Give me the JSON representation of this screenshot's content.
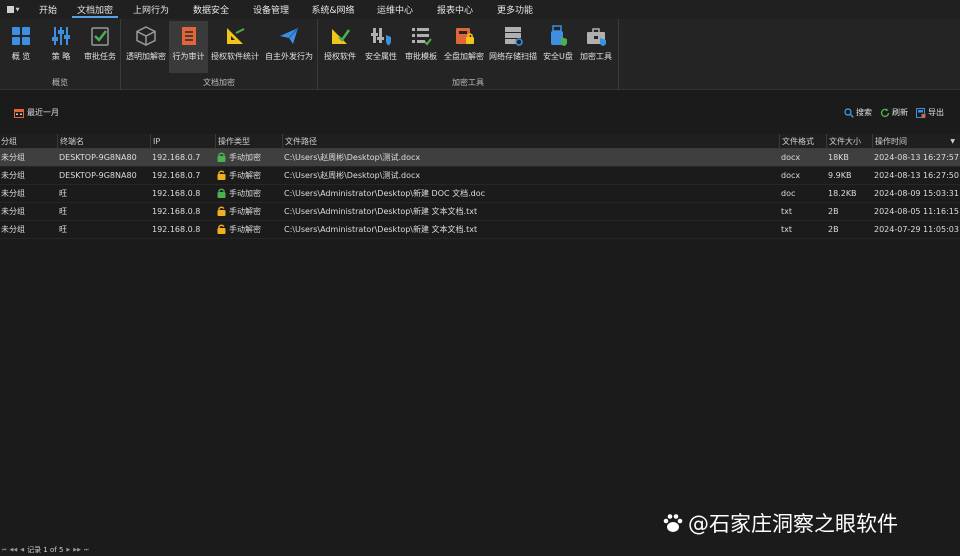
{
  "menubar": {
    "tabs": [
      {
        "label": "开始",
        "active": false
      },
      {
        "label": "文档加密",
        "active": true
      },
      {
        "label": "上网行为",
        "active": false
      },
      {
        "label": "数据安全",
        "active": false
      },
      {
        "label": "设备管理",
        "active": false
      },
      {
        "label": "系统&网络",
        "active": false
      },
      {
        "label": "运维中心",
        "active": false
      },
      {
        "label": "报表中心",
        "active": false
      },
      {
        "label": "更多功能",
        "active": false
      }
    ]
  },
  "ribbon": {
    "groups": [
      {
        "label": "概览",
        "buttons": [
          {
            "label": "概 览",
            "icon": "dashboard-icon",
            "color": "#3d8fe0"
          },
          {
            "label": "策 略",
            "icon": "sliders-icon",
            "color": "#3d8fe0"
          },
          {
            "label": "审批任务",
            "icon": "approval-check-icon",
            "color": "#4caf50"
          }
        ]
      },
      {
        "label": "文档加密",
        "buttons": [
          {
            "label": "透明加解密",
            "icon": "cube-icon",
            "color": "#9a9a9a"
          },
          {
            "label": "行为审计",
            "icon": "audit-log-icon",
            "color": "#e0663a"
          },
          {
            "label": "授权软件统计",
            "icon": "chart-ruler-icon",
            "color": "#f0c419"
          },
          {
            "label": "自主外发行为",
            "icon": "paper-plane-icon",
            "color": "#3d8fe0"
          }
        ]
      },
      {
        "label": "加密工具",
        "buttons": [
          {
            "label": "授权软件",
            "icon": "authorize-icon",
            "color": "#f0c419"
          },
          {
            "label": "安全属性",
            "icon": "security-attr-icon",
            "color": "#b0b0b0"
          },
          {
            "label": "审批模板",
            "icon": "template-list-icon",
            "color": "#b0b0b0"
          },
          {
            "label": "全盘加解密",
            "icon": "disk-encrypt-icon",
            "color": "#e0663a"
          },
          {
            "label": "网络存储扫描",
            "icon": "network-storage-icon",
            "color": "#b0b0b0"
          },
          {
            "label": "安全U盘",
            "icon": "usb-shield-icon",
            "color": "#3d8fe0"
          },
          {
            "label": "加密工具",
            "icon": "toolbox-icon",
            "color": "#b0b0b0"
          }
        ]
      }
    ]
  },
  "toolbar": {
    "recent": "最近一月",
    "search": "搜索",
    "refresh": "刷新",
    "export": "导出"
  },
  "table": {
    "columns": [
      "分组",
      "终端名",
      "IP",
      "操作类型",
      "文件路径",
      "文件格式",
      "文件大小",
      "操作时间"
    ],
    "rows": [
      {
        "group": "未分组",
        "terminal": "DESKTOP-9G8NA80",
        "ip": "192.168.0.7",
        "op": "手动加密",
        "op_kind": "encrypt",
        "path": "C:\\Users\\赵周彬\\Desktop\\测试.docx",
        "format": "docx",
        "size": "18KB",
        "time": "2024-08-13 16:27:57",
        "selected": true
      },
      {
        "group": "未分组",
        "terminal": "DESKTOP-9G8NA80",
        "ip": "192.168.0.7",
        "op": "手动解密",
        "op_kind": "decrypt",
        "path": "C:\\Users\\赵周彬\\Desktop\\测试.docx",
        "format": "docx",
        "size": "9.9KB",
        "time": "2024-08-13 16:27:50",
        "selected": false
      },
      {
        "group": "未分组",
        "terminal": "旺",
        "ip": "192.168.0.8",
        "op": "手动加密",
        "op_kind": "encrypt",
        "path": "C:\\Users\\Administrator\\Desktop\\新建 DOC 文档.doc",
        "format": "doc",
        "size": "18.2KB",
        "time": "2024-08-09 15:03:31",
        "selected": false
      },
      {
        "group": "未分组",
        "terminal": "旺",
        "ip": "192.168.0.8",
        "op": "手动解密",
        "op_kind": "decrypt",
        "path": "C:\\Users\\Administrator\\Desktop\\新建 文本文档.txt",
        "format": "txt",
        "size": "2B",
        "time": "2024-08-05 11:16:15",
        "selected": false
      },
      {
        "group": "未分组",
        "terminal": "旺",
        "ip": "192.168.0.8",
        "op": "手动解密",
        "op_kind": "decrypt",
        "path": "C:\\Users\\Administrator\\Desktop\\新建 文本文档.txt",
        "format": "txt",
        "size": "2B",
        "time": "2024-07-29 11:05:03",
        "selected": false
      }
    ]
  },
  "pager": {
    "text": "记录 1 of 5"
  },
  "watermark": {
    "text": "@石家庄洞察之眼软件"
  },
  "colors": {
    "accent": "#5aa0e8",
    "lock_encrypt": "#4caf50",
    "lock_decrypt": "#f0b020"
  }
}
